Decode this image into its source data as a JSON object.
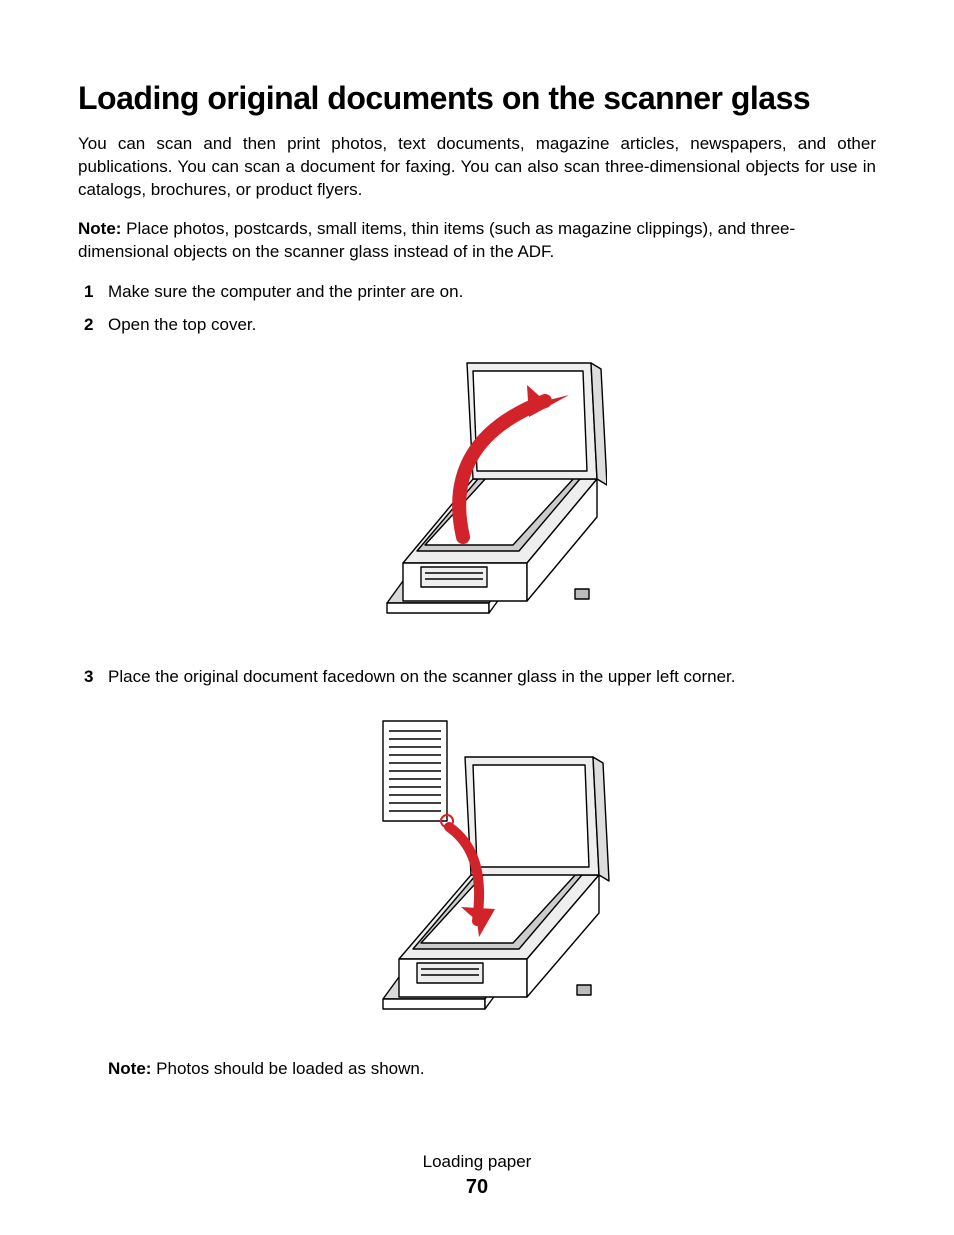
{
  "heading": "Loading original documents on the scanner glass",
  "intro": "You can scan and then print photos, text documents, magazine articles, newspapers, and other publications. You can scan a document for faxing. You can also scan three-dimensional objects for use in catalogs, brochures, or product flyers.",
  "note_label": "Note:",
  "note_body": " Place photos, postcards, small items, thin items (such as magazine clippings), and three-dimensional objects on the scanner glass instead of in the ADF.",
  "steps": [
    {
      "num": "1",
      "text": "Make sure the computer and the printer are on."
    },
    {
      "num": "2",
      "text": "Open the top cover."
    },
    {
      "num": "3",
      "text": "Place the original document facedown on the scanner glass in the upper left corner."
    }
  ],
  "subnote_label": "Note:",
  "subnote_body": " Photos should be loaded as shown.",
  "footer": {
    "section": "Loading paper",
    "page_number": "70"
  },
  "figures": {
    "open_cover": "printer-open-cover-illustration",
    "place_document": "printer-place-document-illustration"
  }
}
